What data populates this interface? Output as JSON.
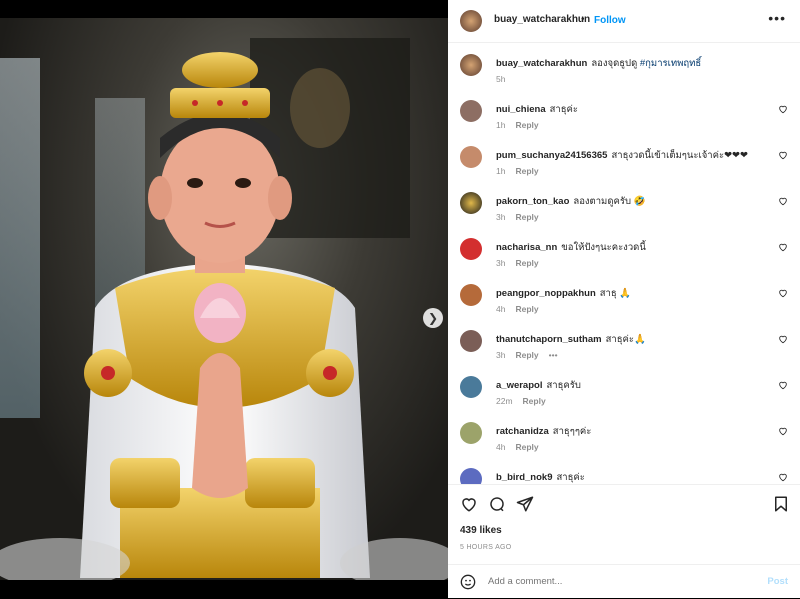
{
  "header": {
    "username": "buay_watcharakhun",
    "separator": "•",
    "follow_label": "Follow",
    "more_label": "•••"
  },
  "caption": {
    "username": "buay_watcharakhun",
    "text": "ลองจุดธูปดู",
    "hashtag": "#กุมารเทพฤทธิ์",
    "time": "5h"
  },
  "comments": [
    {
      "username": "nui_chiena",
      "text": "สาธุค่ะ",
      "time": "1h",
      "reply": "Reply",
      "avatar_color": "#8d6e63"
    },
    {
      "username": "pum_suchanya24156365",
      "text": "สาธุงวดนี้เข้าเต็มๆนะเจ้าค่ะ❤❤❤",
      "time": "1h",
      "reply": "Reply",
      "avatar_color": "#c58b6b"
    },
    {
      "username": "pakorn_ton_kao",
      "text": "ลองตามดูครับ 🤣",
      "time": "3h",
      "reply": "Reply",
      "avatar_color": "#1a1a1a"
    },
    {
      "username": "nacharisa_nn",
      "text": "ขอให้ปังๆนะคะงวดนี้",
      "time": "3h",
      "reply": "Reply",
      "avatar_color": "#d32f2f"
    },
    {
      "username": "peangpor_noppakhun",
      "text": "สาธุ 🙏",
      "time": "4h",
      "reply": "Reply",
      "avatar_color": "#b56a3a"
    },
    {
      "username": "thanutchaporn_sutham",
      "text": "สาธุค่ะ🙏",
      "time": "3h",
      "reply": "Reply",
      "extra": "•••",
      "avatar_color": "#7b5e57"
    },
    {
      "username": "a_werapol",
      "text": "สาธุครับ",
      "time": "22m",
      "reply": "Reply",
      "avatar_color": "#4a7a9a"
    },
    {
      "username": "ratchanidza",
      "text": "สาธุๆๆค่ะ",
      "time": "4h",
      "reply": "Reply",
      "avatar_color": "#9ca36a"
    },
    {
      "username": "b_bird_nok9",
      "text": "สาธุค่ะ",
      "time": "",
      "reply": "",
      "avatar_color": "#5c6bc0"
    }
  ],
  "actions": {
    "likes": "439 likes",
    "time": "5 HOURS AGO"
  },
  "add_comment": {
    "placeholder": "Add a comment...",
    "post_label": "Post"
  },
  "icons": [
    "heart-icon",
    "comment-icon",
    "share-icon",
    "bookmark-icon",
    "emoji-icon",
    "more-icon",
    "chevron-right-icon"
  ],
  "colors": {
    "accent": "#0095f6",
    "post_disabled": "#b2dffc",
    "heart_red": "#ed4956"
  }
}
